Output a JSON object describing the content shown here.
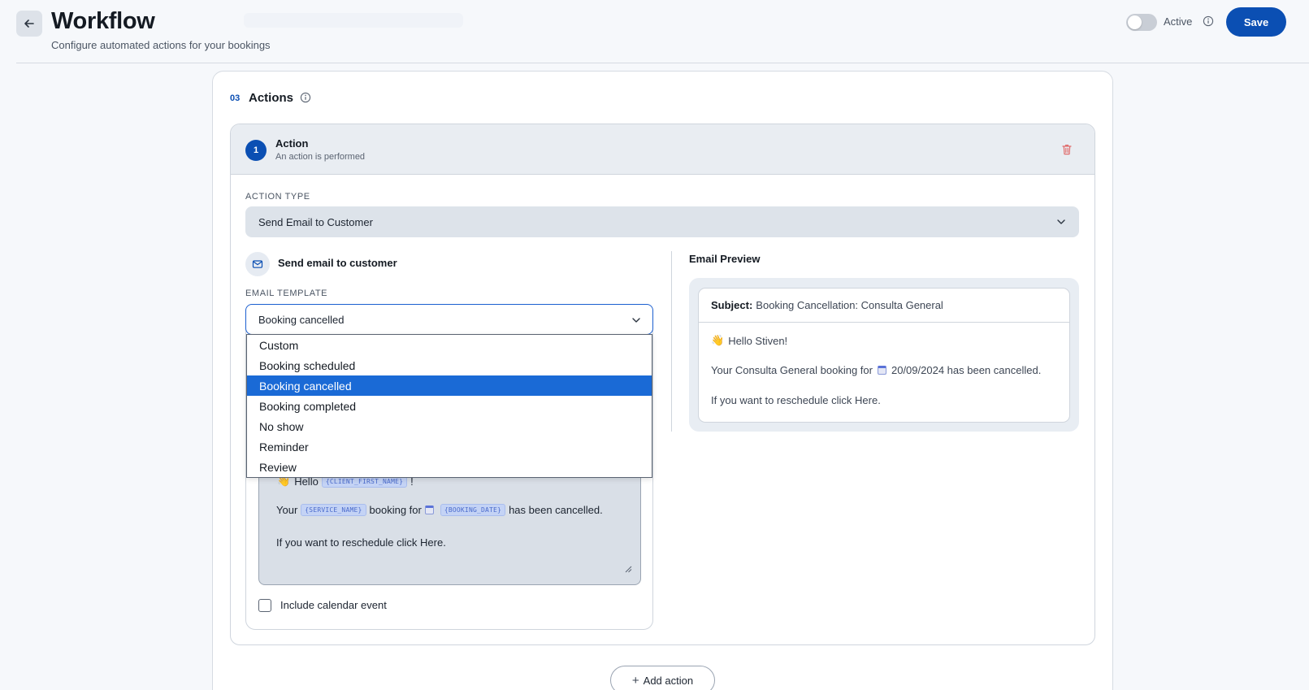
{
  "header": {
    "title": "Workflow",
    "subtitle": "Configure automated actions for your bookings",
    "active_label": "Active",
    "active_on": false,
    "save_label": "Save"
  },
  "section": {
    "number": "03",
    "title": "Actions"
  },
  "action": {
    "badge": "1",
    "title": "Action",
    "subtitle": "An action is performed",
    "type_label": "ACTION TYPE",
    "type_value": "Send Email to Customer",
    "send_title": "Send email to customer",
    "template_label": "EMAIL TEMPLATE",
    "template_value": "Booking cancelled",
    "template_options": [
      "Custom",
      "Booking scheduled",
      "Booking cancelled",
      "Booking completed",
      "No show",
      "Reminder",
      "Review"
    ],
    "selected_option": "Booking cancelled",
    "body": {
      "hello": "Hello",
      "tag_client": "{CLIENT_FIRST_NAME}",
      "exclaim": "!",
      "your": "Your",
      "tag_service": "{SERVICE_NAME}",
      "booking_for": "booking for",
      "tag_date": "{BOOKING_DATE}",
      "cancelled": "has been cancelled.",
      "reschedule": "If you want to reschedule click Here."
    },
    "include_calendar_label": "Include calendar event",
    "include_calendar_checked": false
  },
  "preview": {
    "title": "Email Preview",
    "subject_label": "Subject:",
    "subject_value": "Booking Cancellation: Consulta General",
    "hello_line": "Hello Stiven!",
    "line1_start": "Your Consulta General booking for",
    "line1_end": "20/09/2024 has been cancelled.",
    "line2": "If you want to reschedule click Here."
  },
  "add_action_label": "Add action",
  "colors": {
    "accent": "#0b4fb3",
    "selected_option": "#1a6ad6",
    "danger": "#e06b6b"
  },
  "icons": [
    "arrow-left-icon",
    "info-icon",
    "trash-icon",
    "chevron-down-icon",
    "mail-icon",
    "wave-hand-icon",
    "calendar-icon",
    "plus-icon"
  ]
}
